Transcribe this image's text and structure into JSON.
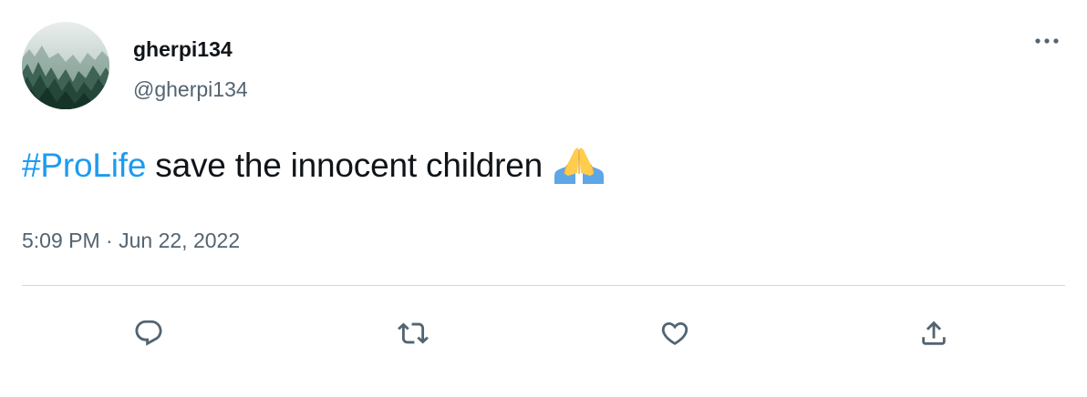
{
  "author": {
    "display_name": "gherpi134",
    "handle": "@gherpi134",
    "avatar": "misty-forest-photo"
  },
  "tweet": {
    "hashtag": "#ProLife",
    "text": " save the innocent children ",
    "emoji": "folded-hands-emoji",
    "time": "5:09 PM",
    "separator": " · ",
    "date": "Jun 22, 2022"
  },
  "actions": {
    "reply_icon": "reply-icon",
    "retweet_icon": "retweet-icon",
    "like_icon": "heart-icon",
    "share_icon": "share-icon",
    "more_icon": "more-icon"
  },
  "colors": {
    "link": "#1d9bf0",
    "secondary_text": "#536471",
    "divider": "#cfd9de"
  }
}
